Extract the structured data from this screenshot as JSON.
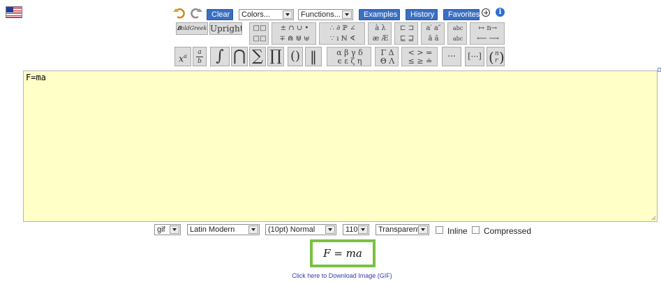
{
  "header": {
    "flag_icon": "us-flag-icon"
  },
  "toolbar": {
    "undo_icon": "undo-icon",
    "redo_icon": "redo-icon",
    "clear_label": "Clear",
    "colors_select": "Colors...",
    "functions_select": "Functions...",
    "examples_label": "Examples",
    "history_label": "History",
    "favorites_label": "Favorites",
    "add_icon": "plus-circle-icon",
    "info_icon": "info-icon",
    "accent_color": "#3a6fc2"
  },
  "style_buttons": {
    "boldgreek_label": "𝑩oldGreek",
    "upright_label": "Upright"
  },
  "symbols": {
    "superscript": "x",
    "superscript_exp": "a",
    "fraction_num": "a",
    "fraction_den": "b",
    "integral": "∫",
    "intersection": "⋂",
    "sum": "∑",
    "product": "∏",
    "parens": "()",
    "norm": "‖",
    "alpha_row": "α β γ δ",
    "epsilon_row": "ϵ ε ζ η",
    "gamma_delta": "Γ Δ",
    "theta_lambda": "Θ Λ",
    "lt_gt_eq": "< > =",
    "le_ge_eq": "≤ ≥ ≐",
    "dots": "⋯",
    "matrix": "[⋯]",
    "binom_n": "n",
    "binom_r": "r"
  },
  "editor": {
    "content": "F=ma"
  },
  "options": {
    "format": "gif",
    "font": "Latin Modern",
    "size": "(10pt) Normal",
    "dpi": "110",
    "background": "Transparent",
    "inline_label": "Inline",
    "compressed_label": "Compressed"
  },
  "preview": {
    "equation": "F = ma",
    "border_color": "#7ac143"
  },
  "download": {
    "link_text": "Click here to Download Image (GIF)"
  }
}
